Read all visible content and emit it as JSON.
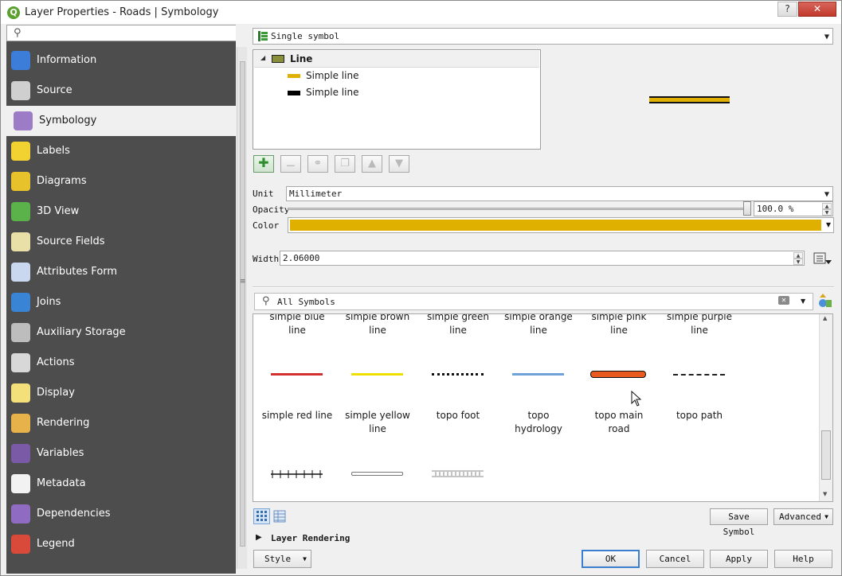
{
  "window": {
    "title": "Layer Properties - Roads | Symbology",
    "app_icon": "qgis-icon",
    "help_btn": "?",
    "close_btn": "✕"
  },
  "sidebar": {
    "search_placeholder": "",
    "items": [
      {
        "label": "Information",
        "icon": "information-icon",
        "color": "#3b7dd8"
      },
      {
        "label": "Source",
        "icon": "source-gear-icon",
        "color": "#cfcfcf"
      },
      {
        "label": "Symbology",
        "icon": "symbology-brush-icon",
        "color": "#9c7bc7",
        "active": true
      },
      {
        "label": "Labels",
        "icon": "labels-abc-icon",
        "color": "#f2d230"
      },
      {
        "label": "Diagrams",
        "icon": "diagrams-icon",
        "color": "#e8c22a"
      },
      {
        "label": "3D View",
        "icon": "3d-view-icon",
        "color": "#5bb24a"
      },
      {
        "label": "Source Fields",
        "icon": "source-fields-icon",
        "color": "#e9e0a8"
      },
      {
        "label": "Attributes Form",
        "icon": "attributes-form-icon",
        "color": "#c9d8ee"
      },
      {
        "label": "Joins",
        "icon": "joins-icon",
        "color": "#3a84d6"
      },
      {
        "label": "Auxiliary Storage",
        "icon": "auxiliary-storage-icon",
        "color": "#bdbdbd"
      },
      {
        "label": "Actions",
        "icon": "actions-gear-icon",
        "color": "#d8d8d8"
      },
      {
        "label": "Display",
        "icon": "display-bubble-icon",
        "color": "#f3e07a"
      },
      {
        "label": "Rendering",
        "icon": "rendering-brush-icon",
        "color": "#e8b24a"
      },
      {
        "label": "Variables",
        "icon": "variables-epsilon-icon",
        "color": "#7a5aa6"
      },
      {
        "label": "Metadata",
        "icon": "metadata-icon",
        "color": "#f2f2f2"
      },
      {
        "label": "Dependencies",
        "icon": "dependencies-icon",
        "color": "#8f6bc2"
      },
      {
        "label": "Legend",
        "icon": "legend-icon",
        "color": "#d94a3a"
      }
    ]
  },
  "renderer": {
    "value": "Single symbol"
  },
  "symbol_tree": {
    "root": "Line",
    "layers": [
      {
        "label": "Simple line",
        "color": "#e0b000"
      },
      {
        "label": "Simple line",
        "color": "#000000"
      }
    ]
  },
  "props": {
    "unit_label": "Unit",
    "unit_value": "Millimeter",
    "opacity_label": "Opacity",
    "opacity_value": "100.0 %",
    "opacity_percent": 100,
    "color_label": "Color",
    "color_value": "#e0b000",
    "width_label": "Width",
    "width_value": "2.06000"
  },
  "library": {
    "search_value": "All Symbols",
    "top_row": [
      "simple blue\nline",
      "simple brown\nline",
      "simple green\nline",
      "simple orange\nline",
      "simple pink\nline",
      "simple purple\nline"
    ],
    "mid_row": [
      "simple red line",
      "simple yellow\nline",
      "topo foot",
      "topo\nhydrology",
      "topo main\nroad",
      "topo path"
    ],
    "mid_colors": [
      "#d22f2f",
      "#f0e000",
      "#111111",
      "#6fa3d8",
      "#e85a1e",
      "#222222"
    ]
  },
  "buttons": {
    "save_symbol": "Save Symbol",
    "advanced": "Advanced",
    "layer_rendering": "Layer Rendering",
    "style": "Style",
    "ok": "OK",
    "cancel": "Cancel",
    "apply": "Apply",
    "help": "Help"
  }
}
